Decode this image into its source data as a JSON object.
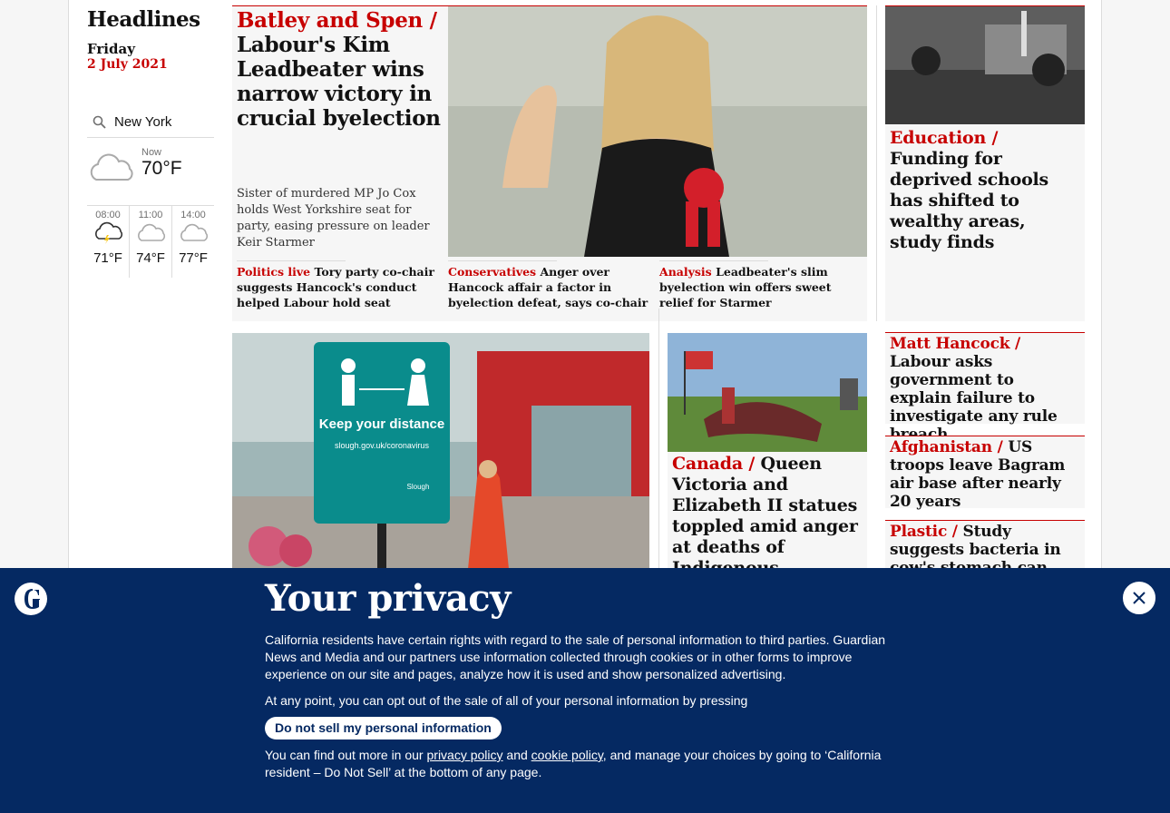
{
  "rail": {
    "title": "Headlines",
    "day": "Friday",
    "date": "2 July 2021",
    "location": "New York",
    "now_label": "Now",
    "now_temp": "70°F",
    "hours": [
      {
        "time": "08:00",
        "temp": "71°F",
        "icon": "storm-cloud-icon"
      },
      {
        "time": "11:00",
        "temp": "74°F",
        "icon": "cloud-icon"
      },
      {
        "time": "14:00",
        "temp": "77°F",
        "icon": "cloud-icon"
      }
    ]
  },
  "lead": {
    "kicker": "Batley and Spen /",
    "headline": "Labour's Kim Leadbeater wins narrow victory in crucial byelection",
    "standfirst": "Sister of murdered MP Jo Cox holds West Yorkshire seat for party, easing pressure on leader Keir Starmer",
    "sublinks": [
      {
        "kicker": "Politics live",
        "text": "Tory party co-chair suggests Hancock's conduct helped Labour hold seat"
      },
      {
        "kicker": "Conservatives",
        "text": "Anger over Hancock affair a factor in byelection defeat, says co-chair"
      },
      {
        "kicker": "Analysis",
        "text": "Leadbeater's slim byelection win offers sweet relief for Starmer"
      }
    ]
  },
  "education": {
    "kicker": "Education /",
    "headline": "Funding for deprived schools has shifted to wealthy areas, study finds"
  },
  "hancock": {
    "kicker": "Matt Hancock /",
    "headline": "Labour asks government to explain failure to investigate any rule breach"
  },
  "afghanistan": {
    "kicker": "Afghanistan /",
    "headline": "US troops leave Bagram air base after nearly 20 years"
  },
  "plastic": {
    "kicker": "Plastic /",
    "headline": "Study suggests bacteria in cow's stomach can break down polyesters"
  },
  "canada": {
    "kicker": "Canada /",
    "headline": "Queen Victoria and Elizabeth II statues toppled amid anger at deaths of Indigenous children"
  },
  "slough_sign": {
    "line1": "Keep your distance",
    "line2": "slough.gov.uk/coronavirus",
    "line3": "Slough"
  },
  "privacy": {
    "title": "Your privacy",
    "para1": "California residents have certain rights with regard to the sale of personal information to third parties. Guardian News and Media and our partners use information collected through cookies or in other forms to improve experience on our site and pages, analyze how it is used and show personalized advertising.",
    "para2": "At any point, you can opt out of the sale of all of your personal information by pressing",
    "button": "Do not sell my personal information",
    "para3_a": "You can find out more in our",
    "link1": "privacy policy",
    "para3_b": "and",
    "link2": "cookie policy",
    "para3_c": ", and manage your choices by going to ‘California resident – Do Not Sell’ at the bottom of any page."
  },
  "colors": {
    "accent": "#c70000",
    "banner": "#052962"
  }
}
